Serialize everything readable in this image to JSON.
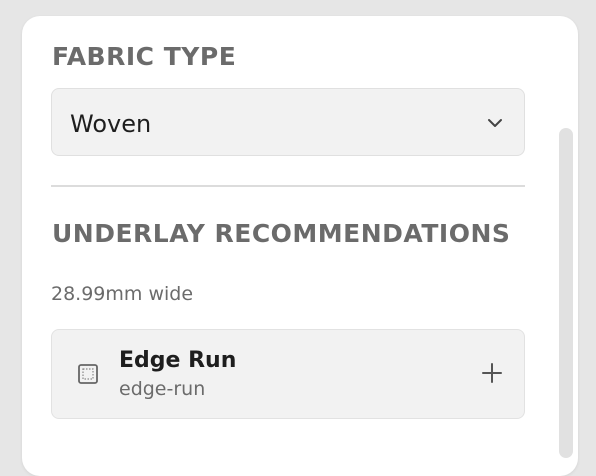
{
  "fabric": {
    "section_title": "FABRIC TYPE",
    "selected_value": "Woven"
  },
  "underlay": {
    "section_title": "UNDERLAY RECOMMENDATIONS",
    "width_label": "28.99mm wide",
    "items": [
      {
        "title": "Edge Run",
        "slug": "edge-run",
        "icon": "dotted-square-icon",
        "action_icon": "plus-icon"
      }
    ]
  },
  "colors": {
    "title_gray": "#6b6b6b",
    "text_dark": "#1e1e1e",
    "field_bg": "#f2f2f2",
    "divider": "#dcdcdc"
  }
}
